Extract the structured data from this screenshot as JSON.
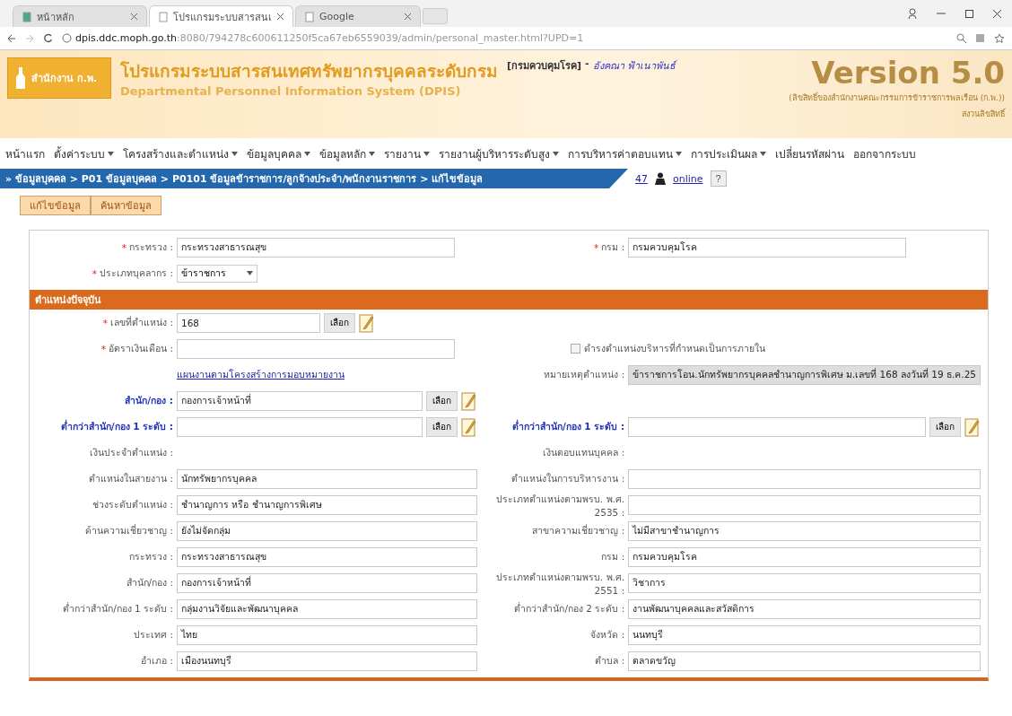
{
  "browser": {
    "tabs": [
      {
        "label": "หน้าหลัก",
        "selected": false
      },
      {
        "label": "โปรแกรมระบบสารสนเ",
        "selected": true
      },
      {
        "label": "Google",
        "selected": false
      }
    ],
    "url_host": "dpis.ddc.moph.go.th",
    "url_path": ":8080/794278c600611250f5ca67eb6559039/admin/personal_master.html?UPD=1"
  },
  "header": {
    "logo": "สำนักงาน ก.พ.",
    "title": "โปรแกรมระบบสารสนเทศทรัพยากรบุคคลระดับกรม",
    "subtitle": "Departmental Personnel Information System (DPIS)",
    "department": "[กรมควบคุมโรค]",
    "separator": "-",
    "user": "อังคณา ฟ้าเนาพันธ์",
    "version": "Version 5.0",
    "copyright": "(ลิขสิทธิ์ของสำนักงานคณะกรรมการข้าราชการพลเรือน (ก.พ.))",
    "copyright_2": "สงวนลิขสิทธิ์"
  },
  "menu": [
    {
      "label": "หน้าแรก",
      "dropdown": false
    },
    {
      "label": "ตั้งค่าระบบ",
      "dropdown": true
    },
    {
      "label": "โครงสร้างและตำแหน่ง",
      "dropdown": true
    },
    {
      "label": "ข้อมูลบุคคล",
      "dropdown": true
    },
    {
      "label": "ข้อมูลหลัก",
      "dropdown": true
    },
    {
      "label": "รายงาน",
      "dropdown": true
    },
    {
      "label": "รายงานผู้บริหารระดับสูง",
      "dropdown": true
    },
    {
      "label": "การบริหารค่าตอบแทน",
      "dropdown": true
    },
    {
      "label": "การประเมินผล",
      "dropdown": true
    },
    {
      "label": "เปลี่ยนรหัสผ่าน",
      "dropdown": false
    },
    {
      "label": "ออกจากระบบ",
      "dropdown": false
    }
  ],
  "breadcrumb": {
    "text": "» ข้อมูลบุคคล > P01 ข้อมูลบุคคล > P0101 ข้อมูลข้าราชการ/ลูกจ้างประจำ/พนักงานราชการ > แก้ไขข้อมูล",
    "online_count": "47",
    "online_label": "online",
    "help": "?"
  },
  "actions": [
    "แก้ไขข้อมูล",
    "ค้นหาข้อมูล"
  ],
  "form": {
    "rows": [
      {
        "kind": "pair",
        "left": {
          "kind": "short-field",
          "label": "กระทรวง :",
          "required_mark": "*",
          "value": "กระทรวงสาธารณสุข"
        },
        "right": {
          "kind": "short-field",
          "label": "กรม :",
          "required_mark": "*",
          "value": "กรมควบคุมโรค"
        }
      },
      {
        "kind": "pair",
        "left": {
          "kind": "select",
          "label": "ประเภทบุคลากร :",
          "required_mark": "*",
          "value": "ข้าราชการ"
        }
      },
      {
        "kind": "section",
        "title": "ตำแหน่งปัจจุบัน"
      },
      {
        "kind": "pair",
        "left": {
          "kind": "pick-short",
          "label": "เลขที่ตำแหน่ง :",
          "required_mark": "*",
          "value": "168",
          "button": "เลือก"
        }
      },
      {
        "kind": "pair",
        "left": {
          "kind": "short-field",
          "label": "อัตราเงินเดือน :",
          "required_mark": "*"
        },
        "right": {
          "kind": "checkbox",
          "label": "ดำรงตำแหน่งบริหารที่กำหนดเป็นการภายใน",
          "checked": false
        }
      },
      {
        "kind": "pair",
        "left": {
          "kind": "link",
          "label": "แผนงานตามโครงสร้างการมอบหมายงาน"
        },
        "right": {
          "kind": "readonly",
          "label": "หมายเหตุตำแหน่ง :",
          "value": "ข้าราชการโอน.นักทรัพยากรบุคคลชำนาญการพิเศษ ม.เลขที่ 168 ลงวันที่ 19 ธ.ค.25"
        }
      },
      {
        "kind": "pair",
        "left": {
          "kind": "pick",
          "label": "สำนัก/กอง :",
          "accent": true,
          "value": "กองการเจ้าหน้าที่",
          "button": "เลือก"
        }
      },
      {
        "kind": "pair",
        "left": {
          "kind": "pick",
          "label": "ต่ำกว่าสำนัก/กอง 1 ระดับ :",
          "accent": true,
          "button": "เลือก"
        },
        "right": {
          "kind": "pick",
          "label": "ต่ำกว่าสำนัก/กอง 1 ระดับ :",
          "accent": true,
          "button": "เลือก"
        }
      },
      {
        "kind": "pair",
        "left": {
          "kind": "text",
          "label": "เงินประจำตำแหน่ง :"
        },
        "right": {
          "kind": "text",
          "label": "เงินตอบแทนบุคคล :"
        }
      },
      {
        "kind": "pair",
        "left": {
          "kind": "field",
          "label": "ตำแหน่งในสายงาน :",
          "value": "นักทรัพยากรบุคคล"
        },
        "right": {
          "kind": "field",
          "label": "ตำแหน่งในการบริหารงาน :"
        }
      },
      {
        "kind": "pair",
        "left": {
          "kind": "field",
          "label": "ช่วงระดับตำแหน่ง :",
          "value": "ชำนาญการ หรือ ชำนาญการพิเศษ"
        },
        "right": {
          "kind": "field",
          "label": "ประเภทตำแหน่งตามพรบ. พ.ศ. 2535 :"
        }
      },
      {
        "kind": "pair",
        "left": {
          "kind": "field",
          "label": "ด้านความเชี่ยวชาญ :",
          "value": "ยังไม่จัดกลุ่ม"
        },
        "right": {
          "kind": "field",
          "label": "สาขาความเชี่ยวชาญ :",
          "value": "ไม่มีสาขาชำนาญการ"
        }
      },
      {
        "kind": "pair",
        "left": {
          "kind": "field",
          "label": "กระทรวง :",
          "value": "กระทรวงสาธารณสุข"
        },
        "right": {
          "kind": "field",
          "label": "กรม :",
          "value": "กรมควบคุมโรค"
        }
      },
      {
        "kind": "pair",
        "left": {
          "kind": "field",
          "label": "สำนัก/กอง :",
          "value": "กองการเจ้าหน้าที่"
        },
        "right": {
          "kind": "field",
          "label": "ประเภทตำแหน่งตามพรบ. พ.ศ. 2551 :",
          "value": "วิชาการ"
        }
      },
      {
        "kind": "pair",
        "left": {
          "kind": "field",
          "label": "ต่ำกว่าสำนัก/กอง 1 ระดับ :",
          "value": "กลุ่มงานวิจัยและพัฒนาบุคคล"
        },
        "right": {
          "kind": "field",
          "label": "ต่ำกว่าสำนัก/กอง 2 ระดับ :",
          "value": "งานพัฒนาบุคคลและสวัสดิการ"
        }
      },
      {
        "kind": "pair",
        "left": {
          "kind": "field",
          "label": "ประเทศ :",
          "value": "ไทย"
        },
        "right": {
          "kind": "field",
          "label": "จังหวัด :",
          "value": "นนทบุรี"
        }
      },
      {
        "kind": "pair",
        "left": {
          "kind": "field",
          "label": "อำเภอ :",
          "value": "เมืองนนทบุรี"
        },
        "right": {
          "kind": "field",
          "label": "ตำบล :",
          "value": "ตลาดขวัญ"
        }
      }
    ]
  }
}
